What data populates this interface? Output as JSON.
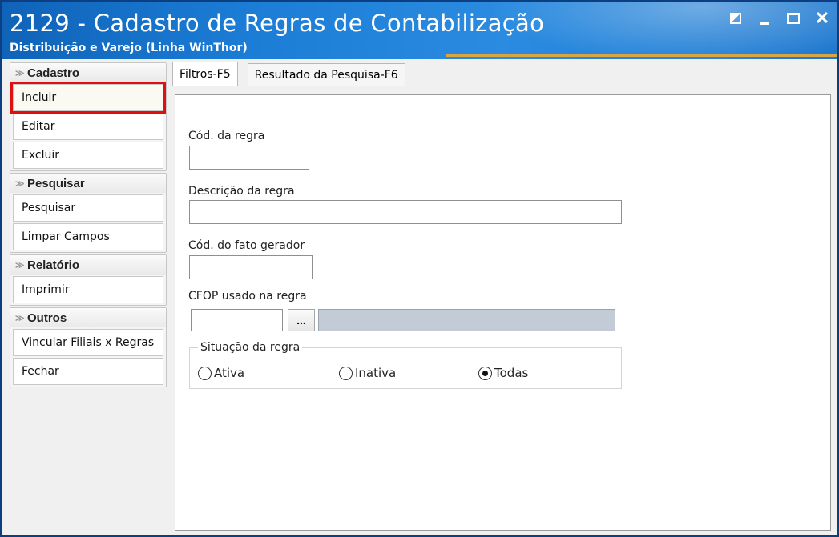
{
  "window": {
    "title": "2129 - Cadastro de Regras de Contabilização",
    "subtitle": "Distribuição e Varejo (Linha WinThor)",
    "controls": [
      "restore-icon",
      "minimize-icon",
      "maximize-icon",
      "close-icon"
    ]
  },
  "sidebar": {
    "groups": [
      {
        "header": "Cadastro",
        "items": [
          {
            "label": "Incluir",
            "selected": true
          },
          {
            "label": "Editar"
          },
          {
            "label": "Excluir"
          }
        ]
      },
      {
        "header": "Pesquisar",
        "items": [
          {
            "label": "Pesquisar"
          },
          {
            "label": "Limpar Campos"
          }
        ]
      },
      {
        "header": "Relatório",
        "items": [
          {
            "label": "Imprimir"
          }
        ]
      },
      {
        "header": "Outros",
        "items": [
          {
            "label": "Vincular Filiais x Regras"
          },
          {
            "label": "Fechar"
          }
        ]
      }
    ]
  },
  "tabs": [
    {
      "label": "Filtros-F5",
      "active": true
    },
    {
      "label": "Resultado da Pesquisa-F6",
      "active": false
    }
  ],
  "form": {
    "cod_regra": {
      "label": "Cód. da regra",
      "value": ""
    },
    "descricao_regra": {
      "label": "Descrição da regra",
      "value": ""
    },
    "cod_fato_gerador": {
      "label": "Cód. do fato gerador",
      "value": ""
    },
    "cfop": {
      "label": "CFOP usado na regra",
      "value": "",
      "button": "...",
      "description": ""
    },
    "situacao": {
      "legend": "Situação da regra",
      "options": [
        "Ativa",
        "Inativa",
        "Todas"
      ],
      "selected": "Todas"
    }
  },
  "colors": {
    "titlebar": "#1c7dd6",
    "highlight_border": "#e01010",
    "disabled_field": "#c3ccd6"
  }
}
